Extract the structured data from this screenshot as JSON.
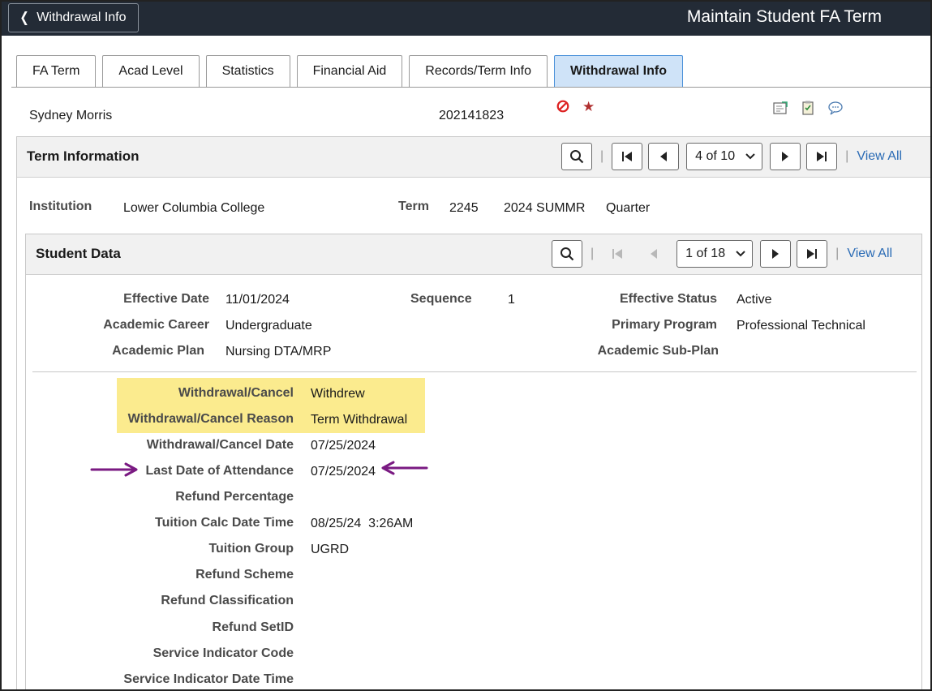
{
  "header": {
    "back_label": "Withdrawal Info",
    "page_title": "Maintain Student FA Term"
  },
  "tabs": [
    {
      "label": "FA Term",
      "active": false
    },
    {
      "label": "Acad Level",
      "active": false
    },
    {
      "label": "Statistics",
      "active": false
    },
    {
      "label": "Financial Aid",
      "active": false
    },
    {
      "label": "Records/Term Info",
      "active": false
    },
    {
      "label": "Withdrawal Info",
      "active": true
    }
  ],
  "person": {
    "name": "Sydney Morris",
    "id": "202141823"
  },
  "term_information": {
    "title": "Term Information",
    "nav_select": "4 of 10",
    "view_all": "View All",
    "institution_label": "Institution",
    "institution_value": "Lower Columbia College",
    "term_label": "Term",
    "term_code": "2245",
    "term_desc": "2024 SUMMR",
    "term_type": "Quarter"
  },
  "student_data": {
    "title": "Student Data",
    "nav_select": "1 of 18",
    "view_all": "View All",
    "effective_date_label": "Effective Date",
    "effective_date": "11/01/2024",
    "sequence_label": "Sequence",
    "sequence": "1",
    "effective_status_label": "Effective Status",
    "effective_status": "Active",
    "academic_career_label": "Academic Career",
    "academic_career": "Undergraduate",
    "primary_program_label": "Primary Program",
    "primary_program": "Professional Technical",
    "academic_plan_label": "Academic Plan",
    "academic_plan": "Nursing DTA/MRP",
    "academic_subplan_label": "Academic Sub-Plan",
    "fields": [
      {
        "label": "Withdrawal/Cancel",
        "value": "Withdrew"
      },
      {
        "label": "Withdrawal/Cancel Reason",
        "value": "Term Withdrawal"
      },
      {
        "label": "Withdrawal/Cancel Date",
        "value": "07/25/2024"
      },
      {
        "label": "Last Date of Attendance",
        "value": "07/25/2024"
      },
      {
        "label": "Refund Percentage",
        "value": ""
      },
      {
        "label": "Tuition Calc Date Time",
        "value": "08/25/24  3:26AM"
      },
      {
        "label": "Tuition Group",
        "value": "UGRD"
      },
      {
        "label": "Refund Scheme",
        "value": ""
      },
      {
        "label": "Refund Classification",
        "value": ""
      },
      {
        "label": "Refund SetID",
        "value": ""
      },
      {
        "label": "Service Indicator Code",
        "value": ""
      },
      {
        "label": "Service Indicator Date Time",
        "value": ""
      }
    ]
  },
  "colors": {
    "header_bg": "#232b36",
    "active_tab": "#cfe3f8",
    "highlight": "#fbeb8e",
    "arrow": "#7a1a82",
    "link": "#2a6bb5"
  }
}
